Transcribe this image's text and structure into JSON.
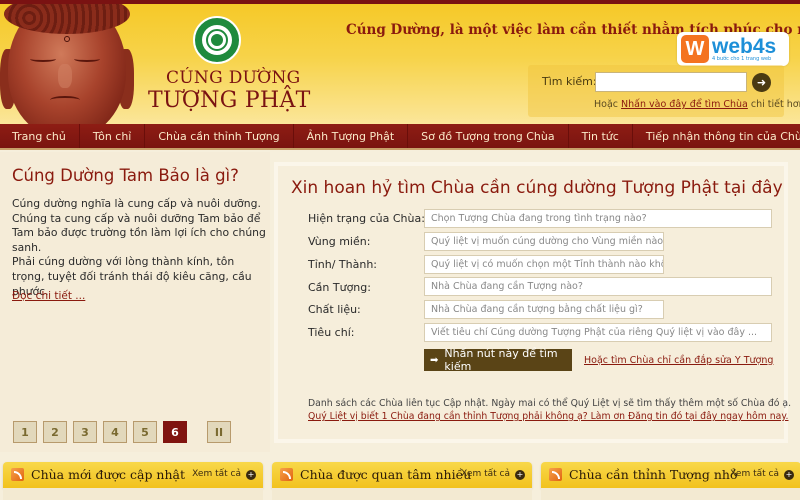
{
  "header": {
    "logo_line1": "CÚNG DƯỜNG",
    "logo_line2": "TƯỢNG PHẬT",
    "emblem_icon": "buddhist-sangha-emblem",
    "tagline": "Cúng Dường, là một việc làm cần thiết nhằm tích phúc cho mình và con cháu.",
    "watermark": {
      "brand": "web4s",
      "letter": "W",
      "sub": "4 bước cho 1 trang web"
    },
    "search": {
      "label": "Tìm kiếm:",
      "value": "",
      "placeholder": "",
      "go_icon": "arrow-right-circle-icon",
      "hint_prefix": "Hoặc",
      "hint_link": "Nhấn vào đây để tìm Chùa",
      "hint_suffix": "chi tiết hơn"
    }
  },
  "nav": {
    "items": [
      {
        "label": "Trang chủ"
      },
      {
        "label": "Tôn chỉ"
      },
      {
        "label": "Chùa cần thỉnh Tượng"
      },
      {
        "label": "Ảnh Tượng Phật"
      },
      {
        "label": "Sơ đồ Tượng trong Chùa"
      },
      {
        "label": "Tin tức"
      },
      {
        "label": "Tiếp nhận thông tin của Chùa"
      }
    ]
  },
  "intro": {
    "title": "Cúng Dường Tam Bảo là gì?",
    "paragraph1": "Cúng dường nghĩa là cung cấp và nuôi dưỡng. Chúng ta cung cấp và nuôi dưỡng Tam bảo để Tam bảo được trường tồn làm lợi ích cho chúng sanh.",
    "paragraph2": "Phải cúng dường với lòng thành kính, tôn trọng, tuyệt đối tránh thái độ kiêu căng, cầu phước.",
    "read_more": "Đọc chi tiết ..."
  },
  "pager": {
    "pages": [
      "1",
      "2",
      "3",
      "4",
      "5",
      "6"
    ],
    "current": "6",
    "pause_label": "II"
  },
  "finder": {
    "title": "Xin hoan hỷ tìm Chùa cần cúng dường Tượng Phật tại đây",
    "fields": [
      {
        "label": "Hiện trạng của Chùa:",
        "placeholder": "Chọn Tượng Chùa đang trong tình trạng nào?"
      },
      {
        "label": "Vùng miền:",
        "placeholder": "Quý liệt vị muốn cúng dường cho Vùng miền nào?"
      },
      {
        "label": "Tỉnh/ Thành:",
        "placeholder": "Quý liệt vị có muốn chọn một Tỉnh thành nào không?"
      },
      {
        "label": "Cần Tượng:",
        "placeholder": "Nhà Chùa đang cần Tượng nào?"
      },
      {
        "label": "Chất liệu:",
        "placeholder": "Nhà Chùa đang cần tượng bằng chất liệu gì?"
      },
      {
        "label": "Tiêu chí:",
        "placeholder": "Viết tiêu chí Cúng dường Tượng Phật của riêng Quý liệt vị vào đây ..."
      }
    ],
    "submit_label": "Nhấn nút này để tìm kiếm",
    "submit_icon": "arrow-right-icon",
    "alt_link": "Hoặc tìm Chùa chỉ cần đắp sửa Y Tượng",
    "note": "Danh sách các Chùa liên tục Cập nhật. Ngày mai có thể Quý Liệt vị sẽ tìm thấy thêm một số Chùa đó ạ.",
    "note_link": "Quý Liệt vị biết 1 Chùa đang cần thỉnh Tượng phải không ạ? Làm ơn Đăng tin đó tại đây ngay hôm nay."
  },
  "boxes": [
    {
      "title": "Chùa mới được cập nhật",
      "view_all": "Xem tất cả",
      "icon": "rss-icon"
    },
    {
      "title": "Chùa được quan tâm nhiều",
      "view_all": "Xem tất cả",
      "icon": "rss-icon"
    },
    {
      "title": "Chùa cần thỉnh Tượng nhỏ",
      "view_all": "Xem tất cả",
      "icon": "rss-icon"
    }
  ],
  "colors": {
    "brand_red": "#7a1212",
    "header_yellow": "#f6c928",
    "button_brown": "#5a4416",
    "page_bg": "#f6efdc",
    "web4s_orange": "#f47320",
    "web4s_blue": "#1d8fd8"
  }
}
